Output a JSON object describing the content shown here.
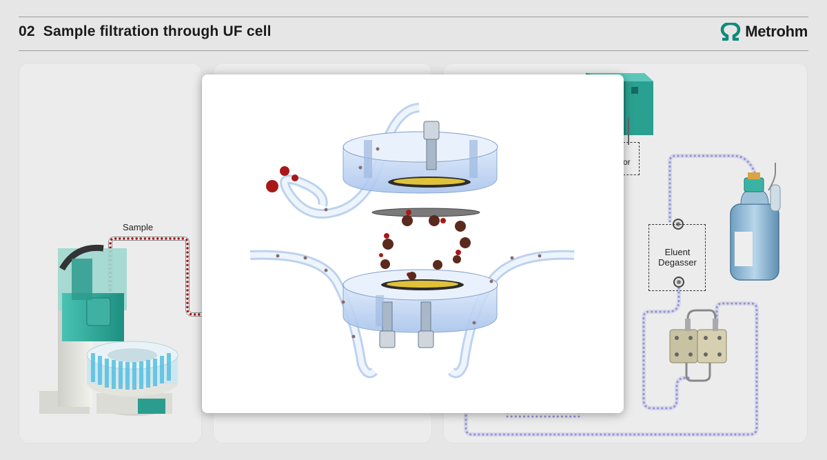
{
  "header": {
    "number": "02",
    "title": "Sample filtration through UF cell",
    "logo_text": "Metrohm"
  },
  "labels": {
    "sample": "Sample",
    "degasser_line1": "Eluent",
    "degasser_line2": "Degasser",
    "detector_fragment": "or"
  },
  "colors": {
    "brand_teal": "#2a9d8f",
    "sample_dots": "#a81818",
    "eluent_dots": "#8f8fd8",
    "panel_bg": "#ececec"
  }
}
